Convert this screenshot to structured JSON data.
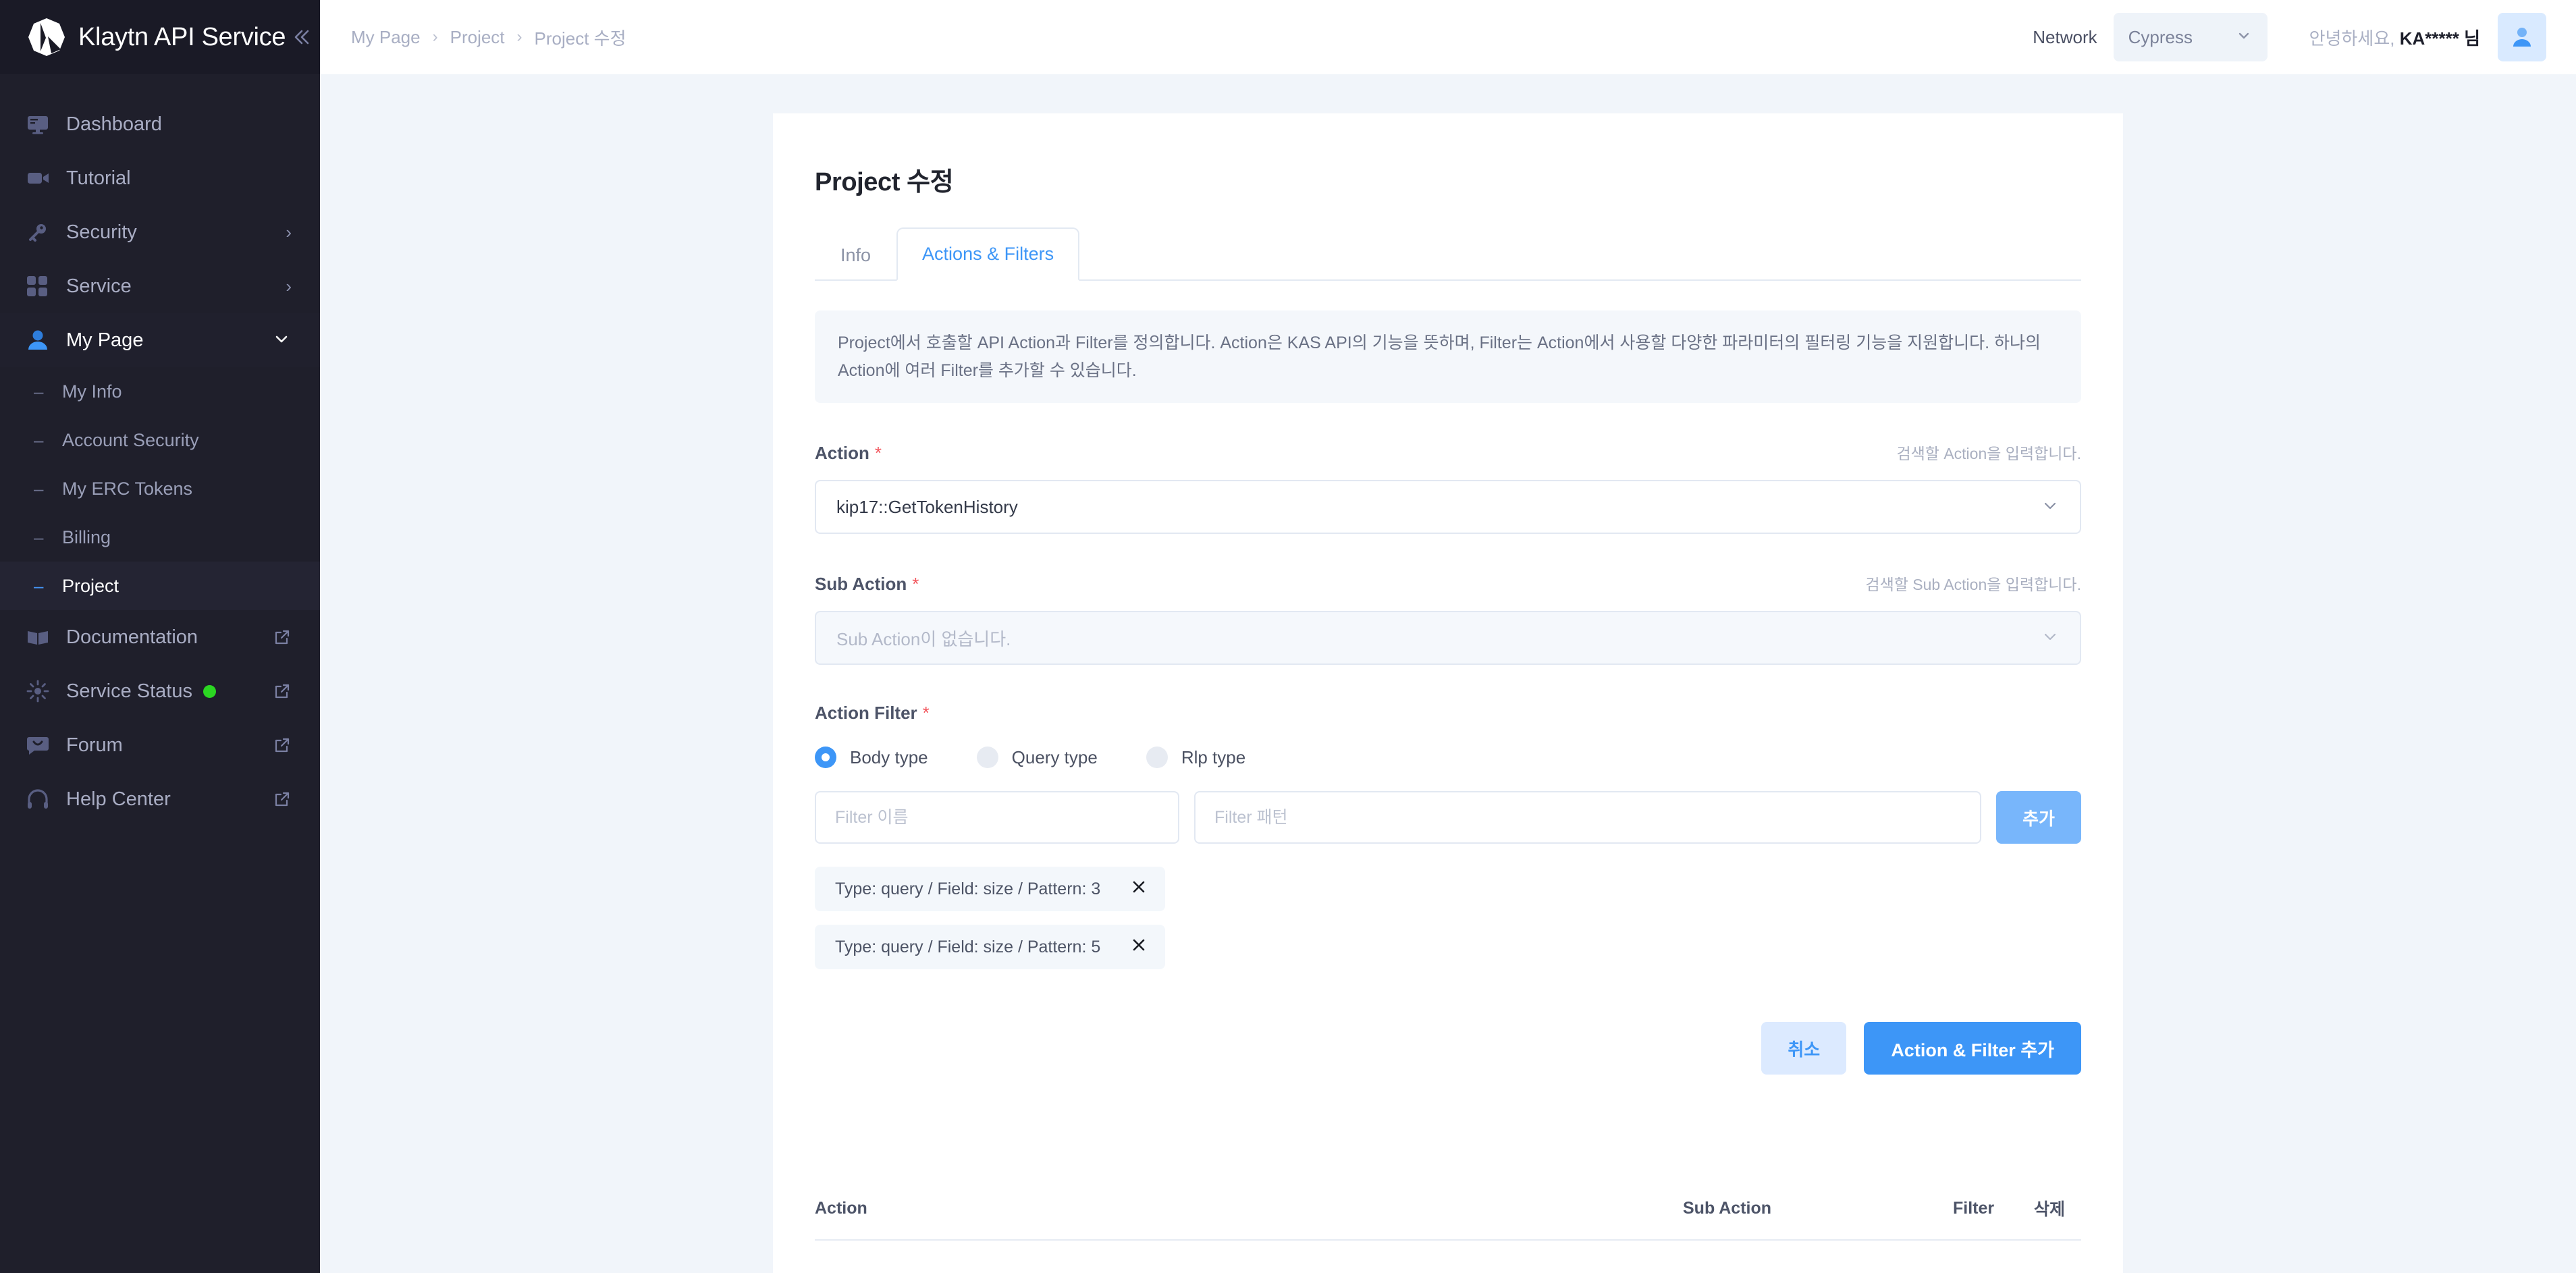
{
  "sidebar": {
    "brand": "Klaytn API Service",
    "collapse_icon": "chevron-double-left-icon",
    "items": [
      {
        "label": "Dashboard",
        "icon": "monitor-icon",
        "caret": "",
        "external": false
      },
      {
        "label": "Tutorial",
        "icon": "video-camera-icon",
        "caret": "",
        "external": false
      },
      {
        "label": "Security",
        "icon": "key-icon",
        "caret": "›",
        "external": false
      },
      {
        "label": "Service",
        "icon": "grid-icon",
        "caret": "›",
        "external": false
      },
      {
        "label": "My Page",
        "icon": "person-icon",
        "caret": "⌄",
        "external": false
      }
    ],
    "my_page_children": [
      {
        "label": "My Info",
        "active": false
      },
      {
        "label": "Account Security",
        "active": false
      },
      {
        "label": "My ERC Tokens",
        "active": false
      },
      {
        "label": "Billing",
        "active": false
      },
      {
        "label": "Project",
        "active": true
      }
    ],
    "footer_items": [
      {
        "label": "Documentation",
        "icon": "book-icon",
        "status": false
      },
      {
        "label": "Service Status",
        "icon": "sun-icon",
        "status": true
      },
      {
        "label": "Forum",
        "icon": "chat-icon",
        "status": false
      },
      {
        "label": "Help Center",
        "icon": "headset-icon",
        "status": false
      }
    ],
    "status_color": "#2bd622"
  },
  "topbar": {
    "breadcrumb": [
      "My Page",
      "Project",
      "Project 수정"
    ],
    "separator": "›",
    "network_label": "Network",
    "network_value": "Cypress",
    "greeting_prefix": "안녕하세요, ",
    "greeting_user": "KA***** 님",
    "avatar_icon": "user-avatar-icon"
  },
  "page": {
    "title": "Project 수정",
    "tabs": [
      {
        "label": "Info",
        "active": false
      },
      {
        "label": "Actions & Filters",
        "active": true
      }
    ],
    "banner": "Project에서 호출할 API Action과 Filter를 정의합니다. Action은 KAS API의 기능을 뜻하며, Filter는 Action에서 사용할 다양한 파라미터의 필터링 기능을 지원합니다. 하나의 Action에 여러 Filter를 추가할 수 있습니다.",
    "action_field": {
      "label": "Action",
      "required_mark": "*",
      "hint": "검색할 Action을 입력합니다.",
      "value": "kip17::GetTokenHistory",
      "caret": "⌄"
    },
    "sub_action_field": {
      "label": "Sub Action",
      "required_mark": "*",
      "hint": "검색할 Sub Action을 입력합니다.",
      "placeholder": "Sub Action이 없습니다.",
      "caret": "⌄"
    },
    "action_filter": {
      "label": "Action Filter",
      "required_mark": "*",
      "options": [
        {
          "label": "Body type",
          "checked": true
        },
        {
          "label": "Query type",
          "checked": false
        },
        {
          "label": "Rlp type",
          "checked": false
        }
      ],
      "name_placeholder": "Filter 이름",
      "name_value": "",
      "pattern_placeholder": "Filter 패턴",
      "pattern_value": "",
      "add_button": "추가",
      "chips": [
        {
          "text": "Type: query / Field: size / Pattern: 3",
          "remove_icon": "close-icon"
        },
        {
          "text": "Type: query / Field: size / Pattern: 5",
          "remove_icon": "close-icon"
        }
      ]
    },
    "form_actions": {
      "cancel": "취소",
      "submit": "Action & Filter 추가"
    },
    "table": {
      "columns": [
        "Action",
        "Sub Action",
        "Filter",
        "삭제"
      ],
      "rows": []
    }
  },
  "colors": {
    "accent": "#3d96f7",
    "sidebar_bg": "#1f1f2b",
    "page_bg": "#f1f5fa",
    "required": "#f2545b",
    "status_green": "#2bd622"
  }
}
